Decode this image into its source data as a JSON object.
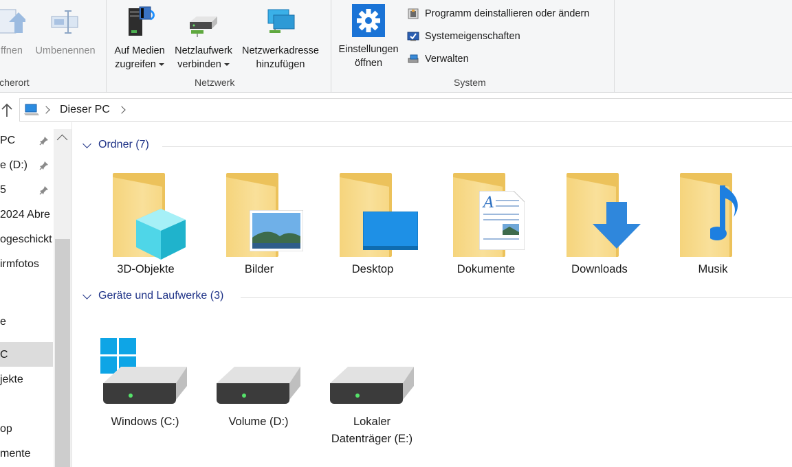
{
  "ribbon": {
    "left_partial": {
      "btn_open": "ffnen",
      "btn_rename": "Umbenennen",
      "group_label": "icherort"
    },
    "network": {
      "group_label": "Netzwerk",
      "media": [
        "Auf Medien",
        "zugreifen"
      ],
      "map_drive": [
        "Netzlaufwerk",
        "verbinden"
      ],
      "add_location": [
        "Netzwerkadresse",
        "hinzufügen"
      ]
    },
    "system": {
      "group_label": "System",
      "settings": [
        "Einstellungen",
        "öffnen"
      ],
      "uninstall": "Programm deinstallieren oder ändern",
      "properties": "Systemeigenschaften",
      "manage": "Verwalten"
    }
  },
  "address": {
    "crumb": "Dieser PC"
  },
  "nav": {
    "items": [
      {
        "label": "PC",
        "pinned": true
      },
      {
        "label": "e (D:)",
        "pinned": true
      },
      {
        "label": "5",
        "pinned": true
      },
      {
        "label": "2024 Abre",
        "pinned": false
      },
      {
        "label": "ogeschickt",
        "pinned": false
      },
      {
        "label": "irmfotos",
        "pinned": false
      },
      {
        "label": "e",
        "pinned": false
      },
      {
        "label": "C",
        "pinned": false
      },
      {
        "label": "jekte",
        "pinned": false
      },
      {
        "label": "op",
        "pinned": false
      },
      {
        "label": "mente",
        "pinned": false
      }
    ]
  },
  "content": {
    "folders_header": "Ordner (7)",
    "drives_header": "Geräte und Laufwerke (3)",
    "folders": [
      "3D-Objekte",
      "Bilder",
      "Desktop",
      "Dokumente",
      "Downloads",
      "Musik"
    ],
    "drives": [
      {
        "label": "Windows (C:)"
      },
      {
        "label": "Volume (D:)"
      },
      {
        "label": "Lokaler Datenträger (E:)"
      }
    ]
  },
  "colors": {
    "accent_blue": "#1e3287",
    "folder_yellow": "#f5d47c",
    "windows_blue": "#0e9fe0"
  }
}
